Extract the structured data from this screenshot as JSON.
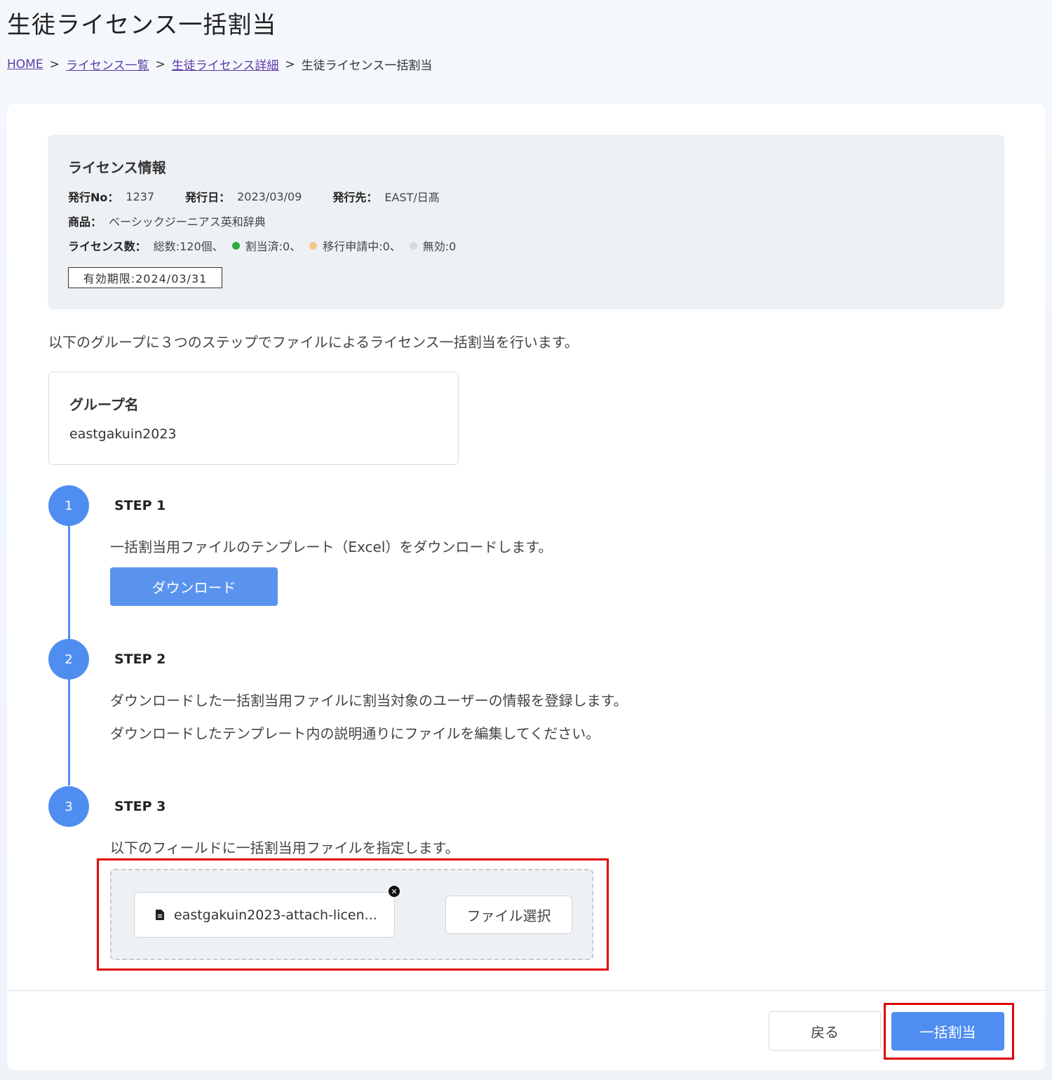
{
  "page": {
    "title": "生徒ライセンス一括割当"
  },
  "breadcrumb": {
    "items": [
      "HOME",
      "ライセンス一覧",
      "生徒ライセンス詳細"
    ],
    "current": "生徒ライセンス一括割当",
    "separator": ">"
  },
  "license_info": {
    "title": "ライセンス情報",
    "issue_no_label": "発行No：",
    "issue_no": "1237",
    "issue_date_label": "発行日：",
    "issue_date": "2023/03/09",
    "issuer_label": "発行先：",
    "issuer": "EAST/日髙",
    "product_label": "商品：",
    "product": "ベーシックジーニアス英和辞典",
    "count_label": "ライセンス数：",
    "total": "総数:120個、",
    "assigned": "割当済:0、",
    "pending": "移行申請中:0、",
    "invalid": "無効:0",
    "expiry": "有効期限:2024/03/31",
    "colors": {
      "assigned": "#2eaa3f",
      "pending": "#f6c888",
      "invalid": "#d9d9d9"
    }
  },
  "intro": "以下のグループに３つのステップでファイルによるライセンス一括割当を行います。",
  "group": {
    "label": "グループ名",
    "value": "eastgakuin2023"
  },
  "steps": [
    {
      "number": "1",
      "title": "STEP 1",
      "lines": [
        "一括割当用ファイルのテンプレート（Excel）をダウンロードします。"
      ],
      "button": "ダウンロード"
    },
    {
      "number": "2",
      "title": "STEP 2",
      "lines": [
        "ダウンロードした一括割当用ファイルに割当対象のユーザーの情報を登録します。",
        "ダウンロードしたテンプレート内の説明通りにファイルを編集してください。"
      ]
    },
    {
      "number": "3",
      "title": "STEP 3",
      "lines": [
        "以下のフィールドに一括割当用ファイルを指定します。"
      ]
    }
  ],
  "file_field": {
    "file_name": "eastgakuin2023-attach-licen...",
    "remove_icon": "close-icon",
    "select_label": "ファイル選択"
  },
  "footer": {
    "back_label": "戻る",
    "assign_label": "一括割当"
  },
  "colors": {
    "accent": "#4f8ef0",
    "highlight": "#e00000"
  }
}
